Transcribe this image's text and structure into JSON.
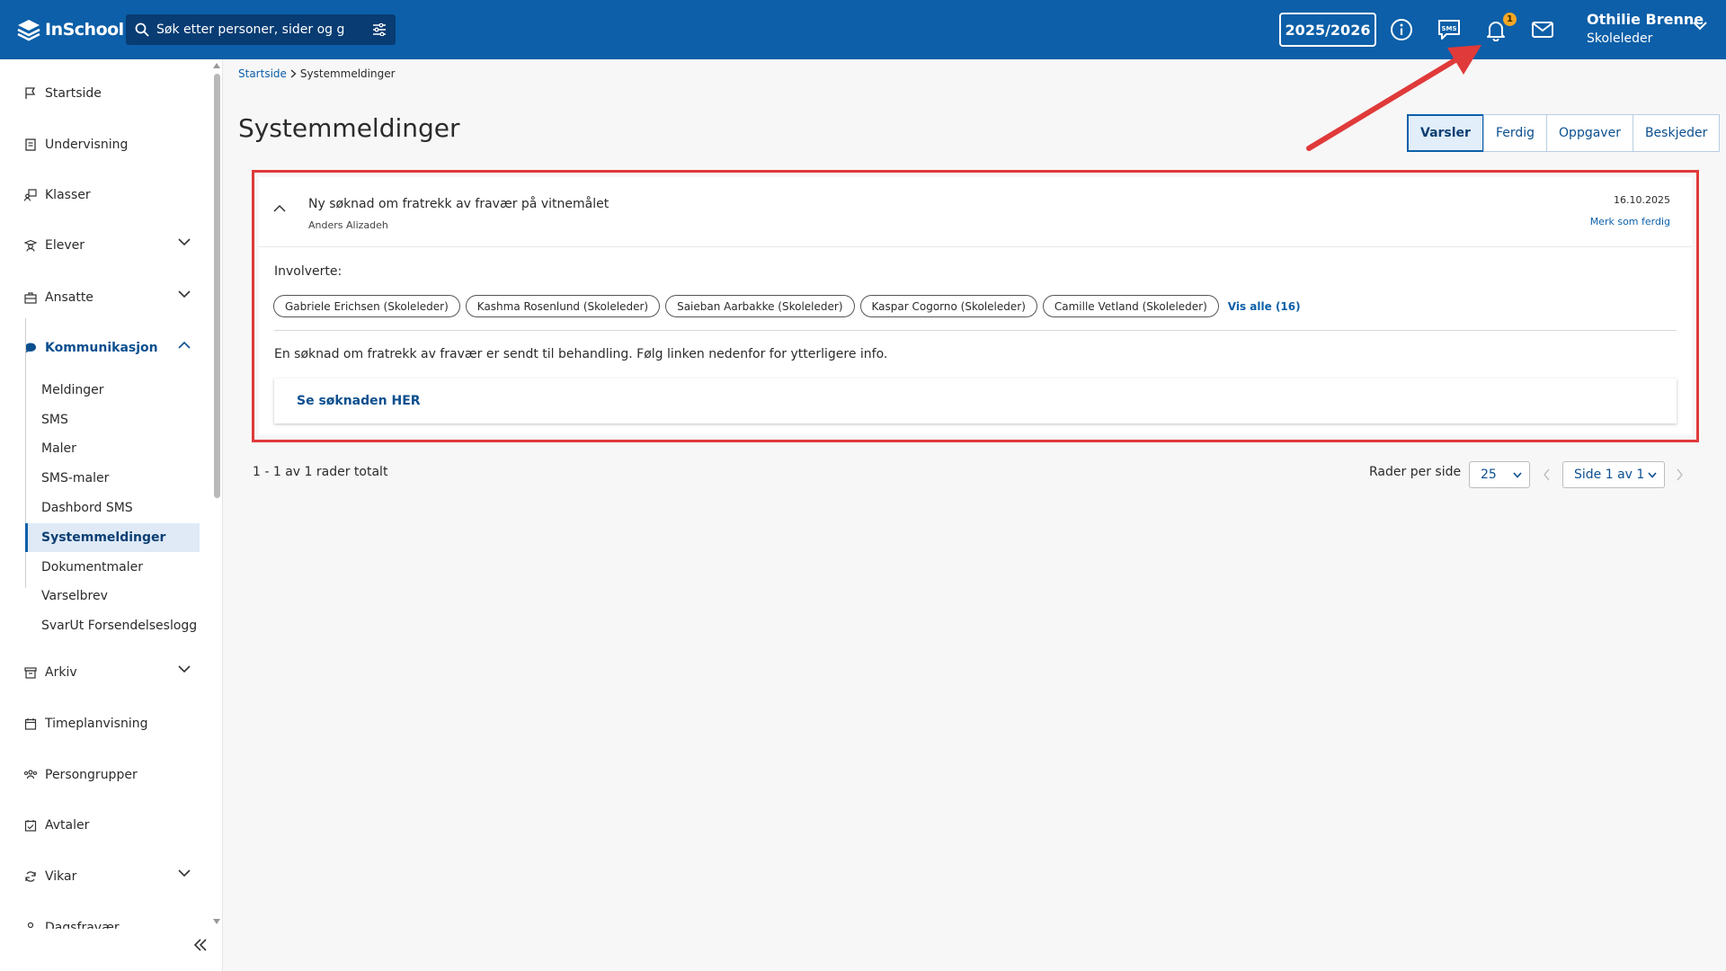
{
  "app": {
    "logo_text": "InSchool"
  },
  "header": {
    "search_placeholder": "Søk etter personer, sider og gru",
    "school_year": "2025/2026",
    "notification_count": "1",
    "user_name": "Othilie Brenne",
    "user_role": "Skoleleder",
    "icons": [
      "info-icon",
      "sms-icon",
      "bell-icon",
      "mail-icon"
    ]
  },
  "sidebar": {
    "items": [
      {
        "label": "Startside",
        "icon": "flag-icon"
      },
      {
        "label": "Undervisning",
        "icon": "book-icon"
      },
      {
        "label": "Klasser",
        "icon": "classroom-icon"
      },
      {
        "label": "Elever",
        "icon": "student-icon"
      },
      {
        "label": "Ansatte",
        "icon": "briefcase-icon"
      },
      {
        "label": "Kommunikasjon",
        "icon": "chat-icon"
      },
      {
        "label": "Arkiv",
        "icon": "archive-icon"
      },
      {
        "label": "Timeplanvisning",
        "icon": "calendar-icon"
      },
      {
        "label": "Persongrupper",
        "icon": "group-icon"
      },
      {
        "label": "Avtaler",
        "icon": "calendar-check-icon"
      },
      {
        "label": "Vikar",
        "icon": "refresh-icon"
      },
      {
        "label": "Dagsfravær",
        "icon": "person-icon"
      }
    ],
    "sub_items": [
      "Meldinger",
      "SMS",
      "Maler",
      "SMS-maler",
      "Dashbord SMS",
      "Systemmeldinger",
      "Dokumentmaler",
      "Varselbrev",
      "SvarUt Forsendelseslogg"
    ],
    "selected_sub_item": "Systemmeldinger"
  },
  "breadcrumb": {
    "home": "Startside",
    "current": "Systemmeldinger"
  },
  "page": {
    "title": "Systemmeldinger"
  },
  "tabs": [
    {
      "label": "Varsler",
      "active": true
    },
    {
      "label": "Ferdig",
      "active": false
    },
    {
      "label": "Oppgaver",
      "active": false
    },
    {
      "label": "Beskjeder",
      "active": false
    }
  ],
  "message": {
    "title": "Ny søknad om fratrekk av fravær på vitnemålet",
    "author": "Anders Alizadeh",
    "date": "16.10.2025",
    "mark_done": "Merk som ferdig",
    "involved_label": "Involverte:",
    "involved": [
      "Gabriele Erichsen (Skoleleder)",
      "Kashma Rosenlund (Skoleleder)",
      "Saieban Aarbakke (Skoleleder)",
      "Kaspar Cogorno (Skoleleder)",
      "Camille Vetland (Skoleleder)"
    ],
    "show_all": "Vis alle (16)",
    "body": "En søknad om fratrekk av fravær er sendt til behandling. Følg linken nedenfor for ytterligere info.",
    "link_text": "Se søknaden HER"
  },
  "pagination": {
    "total_text": "1 - 1 av 1 rader totalt",
    "rows_per_page_label": "Rader per side",
    "rows_per_page": "25",
    "page_select": "Side 1 av 1"
  },
  "colors": {
    "brand": "#0c5fa8",
    "annotation": "#e03a3a",
    "badge": "#f5a623"
  }
}
